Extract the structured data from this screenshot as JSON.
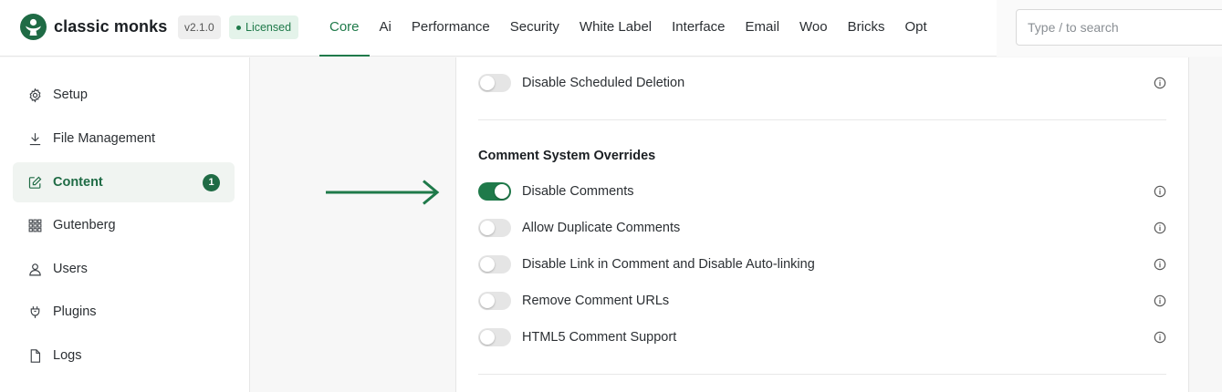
{
  "brand": {
    "name": "classic monks",
    "version": "v2.1.0",
    "license": "Licensed"
  },
  "nav": {
    "items": [
      "Core",
      "Ai",
      "Performance",
      "Security",
      "White Label",
      "Interface",
      "Email",
      "Woo",
      "Bricks",
      "Opt"
    ],
    "active": "Core"
  },
  "search": {
    "placeholder": "Type / to search",
    "value": ""
  },
  "sidebar": {
    "items": [
      {
        "label": "Setup",
        "icon": "gear-icon"
      },
      {
        "label": "File Management",
        "icon": "download-icon"
      },
      {
        "label": "Content",
        "icon": "edit-icon",
        "badge": "1",
        "active": true
      },
      {
        "label": "Gutenberg",
        "icon": "grid-icon"
      },
      {
        "label": "Users",
        "icon": "user-icon"
      },
      {
        "label": "Plugins",
        "icon": "plug-icon"
      },
      {
        "label": "Logs",
        "icon": "file-icon"
      }
    ]
  },
  "settings": {
    "top_row": {
      "label": "Disable Scheduled Deletion",
      "enabled": false
    },
    "section_title": "Comment System Overrides",
    "rows": [
      {
        "label": "Disable Comments",
        "enabled": true
      },
      {
        "label": "Allow Duplicate Comments",
        "enabled": false
      },
      {
        "label": "Disable Link in Comment and Disable Auto-linking",
        "enabled": false
      },
      {
        "label": "Remove Comment URLs",
        "enabled": false
      },
      {
        "label": "HTML5 Comment Support",
        "enabled": false
      }
    ]
  },
  "colors": {
    "accent": "#1f7a4a",
    "brand_dark": "#1f6b45",
    "toggle_off": "#e5e5e5"
  }
}
